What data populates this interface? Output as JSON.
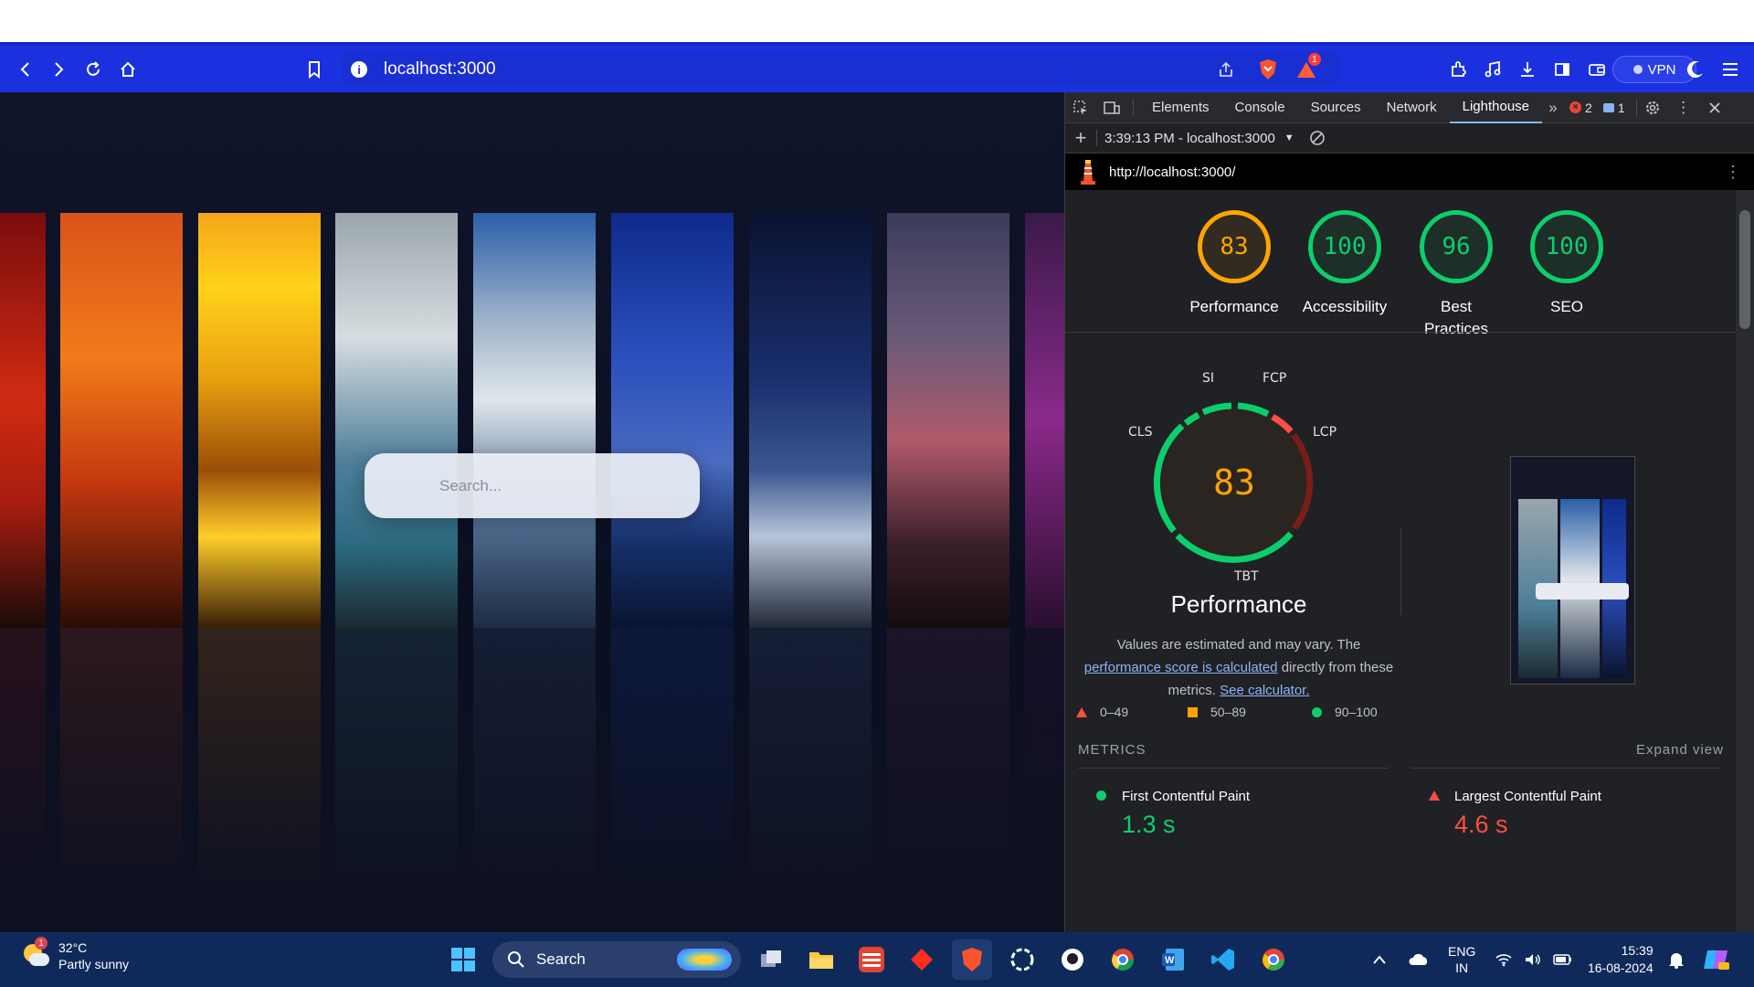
{
  "browser": {
    "url": "localhost:3000",
    "vpn_label": "VPN",
    "notification_count": "1"
  },
  "page": {
    "search_placeholder": "Search..."
  },
  "devtools": {
    "tabs": [
      "Elements",
      "Console",
      "Sources",
      "Network",
      "Lighthouse"
    ],
    "error_count": "2",
    "message_count": "1",
    "report_selector": "3:39:13 PM - localhost:3000",
    "report_url": "http://localhost:3000/"
  },
  "lighthouse": {
    "scores": [
      {
        "label": "Performance",
        "value": "83",
        "color": "#ffa400",
        "fill": 0.83
      },
      {
        "label": "Accessibility",
        "value": "100",
        "color": "#0cce6b",
        "fill": 1.0
      },
      {
        "label": "Best Practices",
        "value": "96",
        "color": "#0cce6b",
        "fill": 0.96
      },
      {
        "label": "SEO",
        "value": "100",
        "color": "#0cce6b",
        "fill": 1.0
      }
    ],
    "perf_gauge": {
      "score": "83",
      "labels": {
        "si": "SI",
        "fcp": "FCP",
        "lcp": "LCP",
        "tbt": "TBT",
        "cls": "CLS"
      }
    },
    "perf_title": "Performance",
    "perf_text_1": "Values are estimated and may vary. The",
    "perf_link_1": "performance score is calculated",
    "perf_text_2": "directly from these metrics.",
    "perf_link_2": "See calculator.",
    "legend": {
      "red": "0–49",
      "orange": "50–89",
      "green": "90–100"
    },
    "metrics_header": "METRICS",
    "expand_label": "Expand view",
    "metrics": [
      {
        "name": "First Contentful Paint",
        "value": "1.3 s",
        "status": "good",
        "color": "#0cce6b"
      },
      {
        "name": "Largest Contentful Paint",
        "value": "4.6 s",
        "status": "poor",
        "color": "#ff4e42"
      }
    ]
  },
  "taskbar": {
    "temp": "32°C",
    "weather": "Partly sunny",
    "weather_badge": "1",
    "search_label": "Search",
    "lang_1": "ENG",
    "lang_2": "IN",
    "time": "15:39",
    "date": "16-08-2024"
  }
}
